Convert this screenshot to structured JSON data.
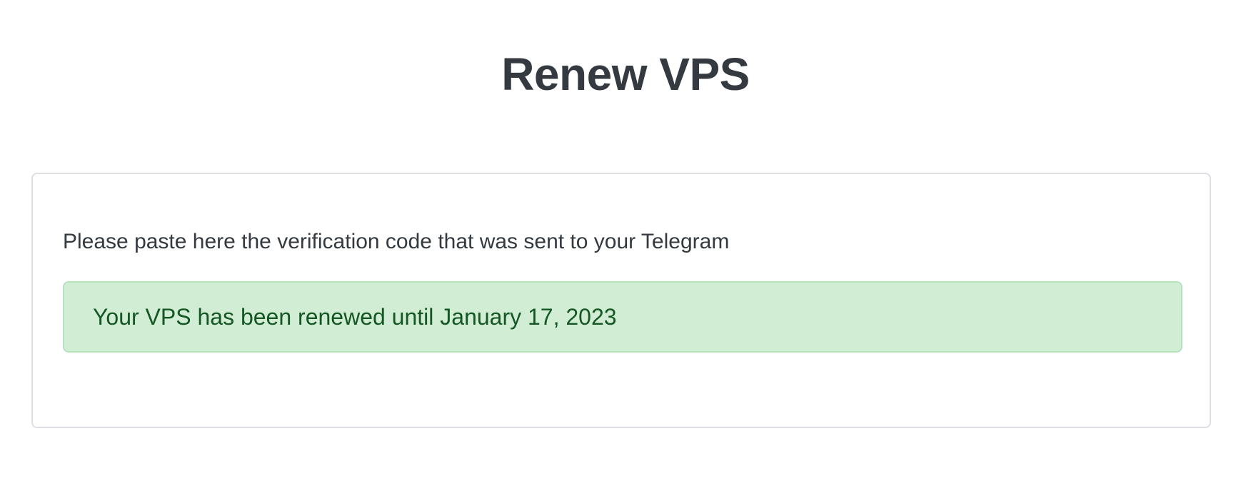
{
  "page": {
    "title": "Renew VPS"
  },
  "card": {
    "instructions": "Please paste here the verification code that was sent to your Telegram",
    "alert": {
      "type": "success",
      "message": "Your VPS has been renewed until January 17, 2023"
    }
  },
  "colors": {
    "text": "#343a40",
    "card_border": "#dddfe2",
    "alert_background": "#d1edd4",
    "alert_border": "#b8e2bf",
    "alert_text": "#155724"
  }
}
